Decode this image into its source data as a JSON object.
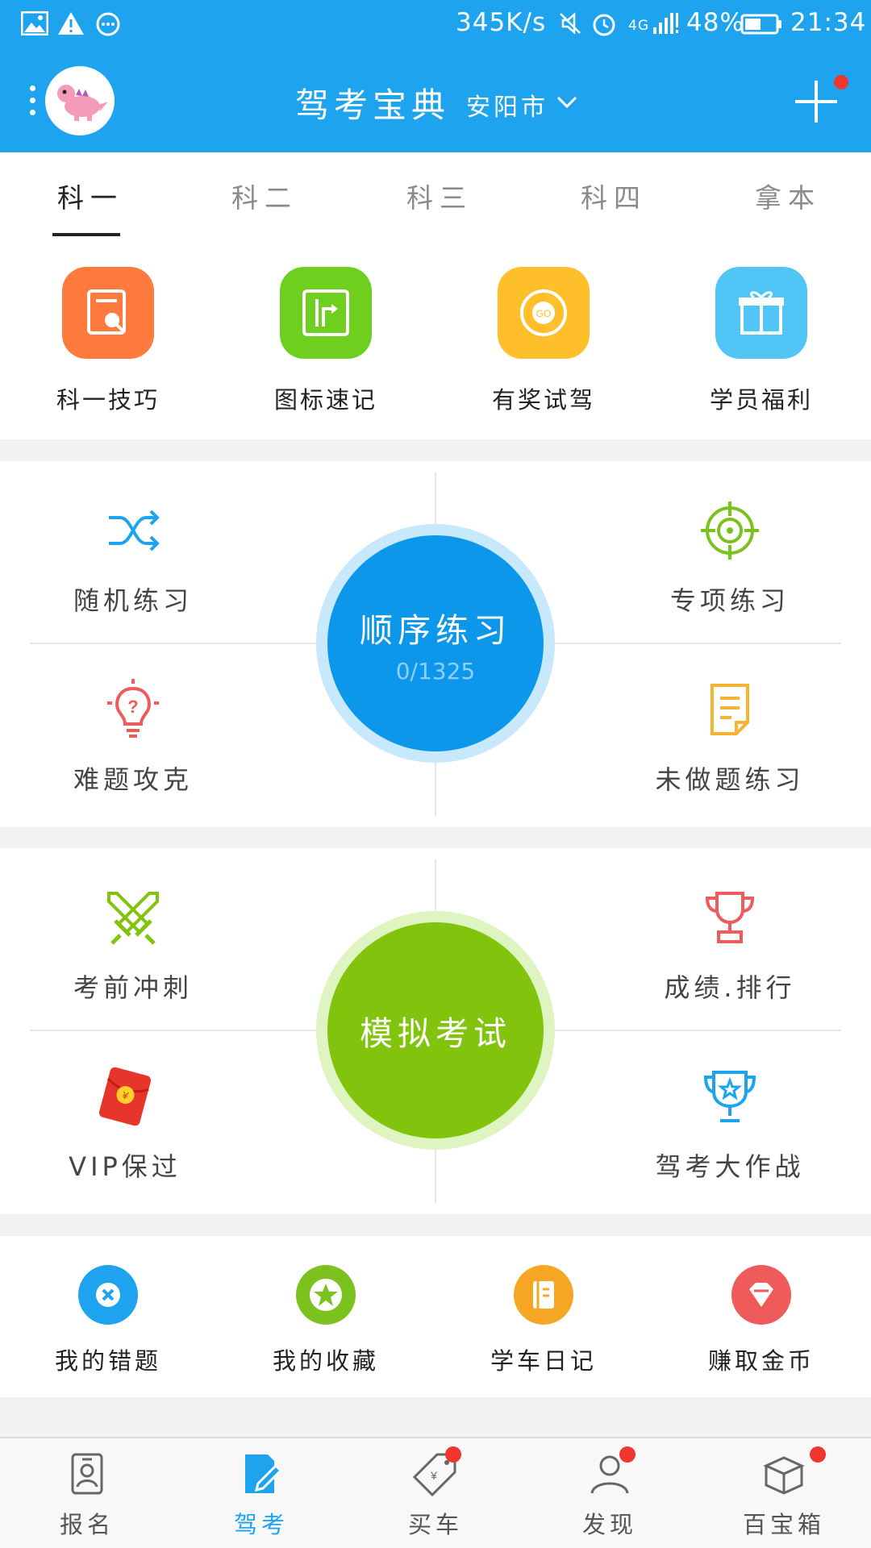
{
  "status_bar": {
    "net_speed": "345K/s",
    "network": "4G",
    "battery": "48%",
    "time": "21:34"
  },
  "header": {
    "title": "驾考宝典",
    "city": "安阳市",
    "avatar_icon": "pink-dinosaur-avatar",
    "add_icon": "plus-icon"
  },
  "tabs": [
    {
      "label": "科一",
      "active": true
    },
    {
      "label": "科二",
      "active": false
    },
    {
      "label": "科三",
      "active": false
    },
    {
      "label": "科四",
      "active": false
    },
    {
      "label": "拿本",
      "active": false
    }
  ],
  "quick_tiles": [
    {
      "label": "科一技巧",
      "icon": "certificate-icon",
      "color": "#ff7a3c"
    },
    {
      "label": "图标速记",
      "icon": "road-sign-icon",
      "color": "#6fcf1f"
    },
    {
      "label": "有奖试驾",
      "icon": "go-wheel-icon",
      "color": "#ffbf2a"
    },
    {
      "label": "学员福利",
      "icon": "gift-icon",
      "color": "#52c5f7"
    }
  ],
  "practice": {
    "center_label": "顺序练习",
    "center_progress": "0/1325",
    "center_color": "#0d97ea",
    "items": [
      {
        "label": "随机练习",
        "icon": "shuffle-icon",
        "color": "#1ea4ee"
      },
      {
        "label": "专项练习",
        "icon": "target-icon",
        "color": "#7cc21e"
      },
      {
        "label": "难题攻克",
        "icon": "bulb-question-icon",
        "color": "#ef5a5a"
      },
      {
        "label": "未做题练习",
        "icon": "note-icon",
        "color": "#f5b431"
      }
    ]
  },
  "exam": {
    "center_label": "模拟考试",
    "center_color": "#82c40d",
    "items": [
      {
        "label": "考前冲刺",
        "icon": "crossed-swords-icon",
        "color": "#82c40d"
      },
      {
        "label": "成绩.排行",
        "icon": "trophy-icon",
        "color": "#ef5a5a"
      },
      {
        "label": "VIP保过",
        "icon": "red-envelope-icon",
        "color": "#e8352c"
      },
      {
        "label": "驾考大作战",
        "icon": "cup-star-icon",
        "color": "#1ea4ee"
      }
    ]
  },
  "mine": [
    {
      "label": "我的错题",
      "icon": "wrong-icon",
      "color": "#1ea4ee"
    },
    {
      "label": "我的收藏",
      "icon": "star-icon",
      "color": "#7cc21e"
    },
    {
      "label": "学车日记",
      "icon": "diary-icon",
      "color": "#f5a623"
    },
    {
      "label": "赚取金币",
      "icon": "diamond-icon",
      "color": "#ef5a5a"
    }
  ],
  "bottom_nav": [
    {
      "label": "报名",
      "icon": "id-card-icon",
      "active": false,
      "badge": false
    },
    {
      "label": "驾考",
      "icon": "edit-doc-icon",
      "active": true,
      "badge": false
    },
    {
      "label": "买车",
      "icon": "price-tag-icon",
      "active": false,
      "badge": true
    },
    {
      "label": "发现",
      "icon": "person-icon",
      "active": false,
      "badge": true
    },
    {
      "label": "百宝箱",
      "icon": "box-icon",
      "active": false,
      "badge": true
    }
  ]
}
